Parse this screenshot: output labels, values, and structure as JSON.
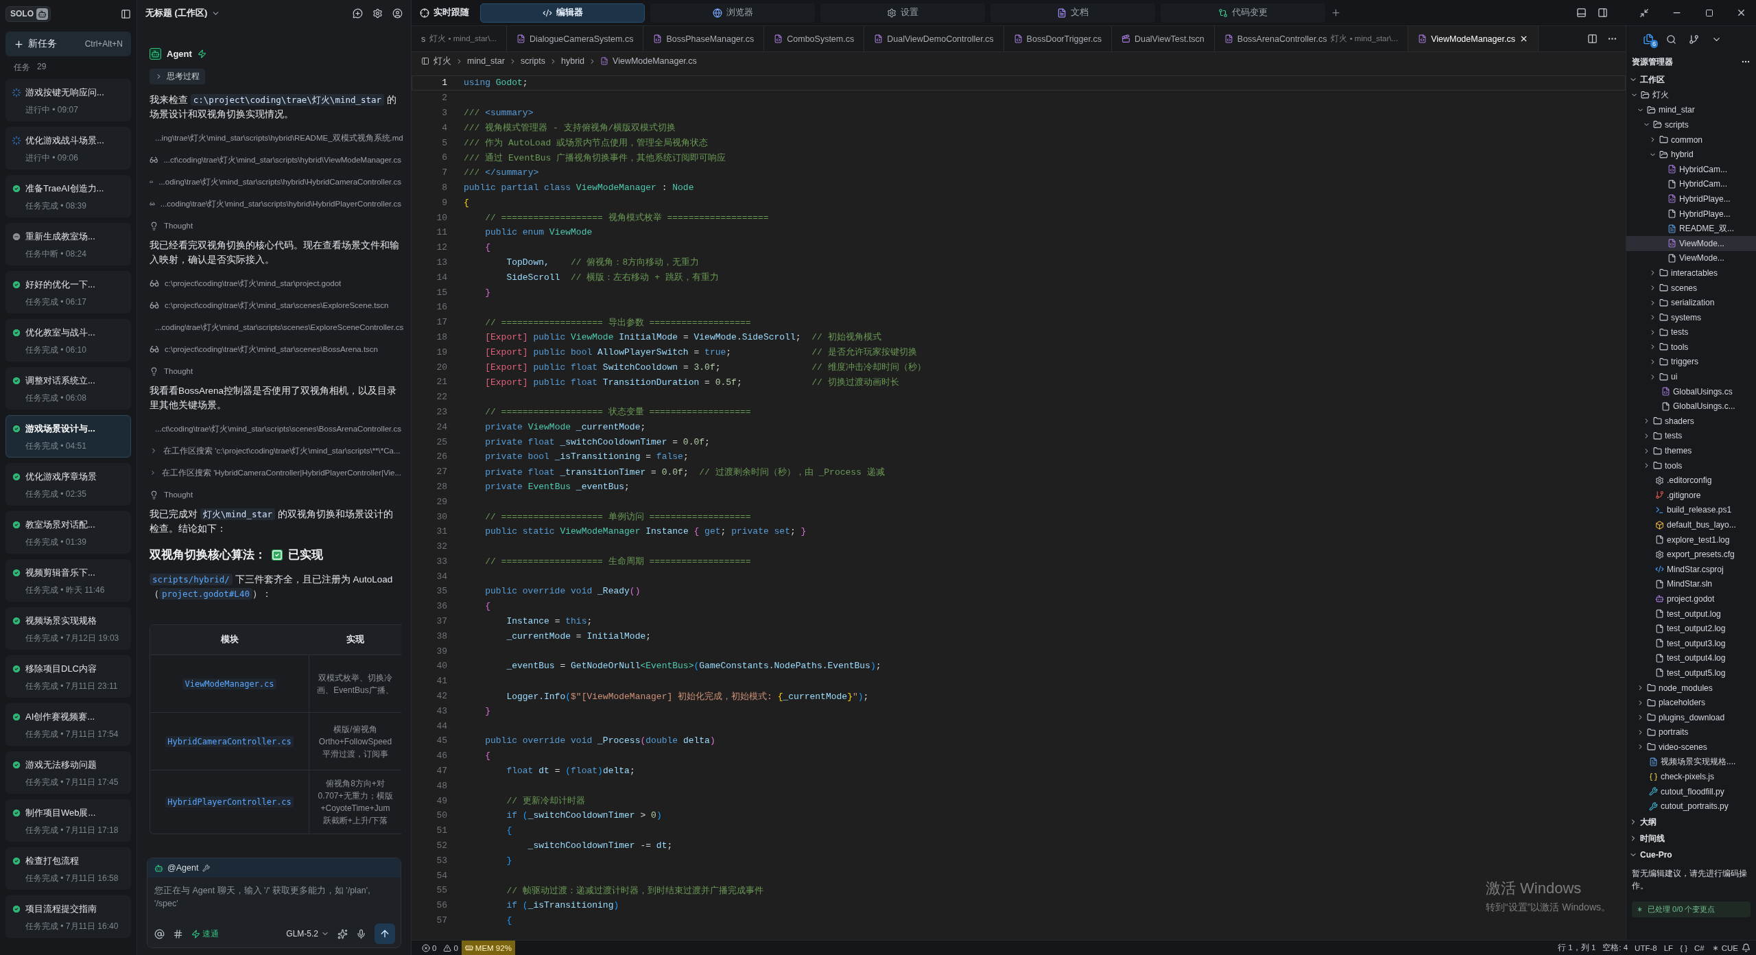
{
  "sidebar": {
    "brand": "SOLO",
    "new_task": {
      "label": "新任务",
      "shortcut": "Ctrl+Alt+N"
    },
    "tasks_label": "任务",
    "tasks_count": "29",
    "tasks": [
      {
        "title": "游戏按键无响应问...",
        "meta": "进行中 • 09:07",
        "kind": "running",
        "selected": false
      },
      {
        "title": "优化游戏战斗场景...",
        "meta": "进行中 • 09:06",
        "kind": "running",
        "selected": false
      },
      {
        "title": "准备TraeAI创造力...",
        "meta": "任务完成 • 08:39",
        "kind": "done",
        "selected": false
      },
      {
        "title": "重新生成教室场...",
        "meta": "任务中断 • 08:24",
        "kind": "stopped",
        "selected": false
      },
      {
        "title": "好好的优化一下...",
        "meta": "任务完成 • 06:17",
        "kind": "done",
        "selected": false
      },
      {
        "title": "优化教室与战斗...",
        "meta": "任务完成 • 06:10",
        "kind": "done",
        "selected": false
      },
      {
        "title": "调整对话系统立...",
        "meta": "任务完成 • 06:08",
        "kind": "done",
        "selected": false
      },
      {
        "title": "游戏场景设计与...",
        "meta": "任务完成 • 04:51",
        "kind": "done",
        "selected": true
      },
      {
        "title": "优化游戏序章场景",
        "meta": "任务完成 • 02:35",
        "kind": "done",
        "selected": false
      },
      {
        "title": "教室场景对话配...",
        "meta": "任务完成 • 01:39",
        "kind": "done",
        "selected": false
      },
      {
        "title": "视频剪辑音乐下...",
        "meta": "任务完成 • 昨天 11:46",
        "kind": "done",
        "selected": false
      },
      {
        "title": "视频场景实现规格",
        "meta": "任务完成 • 7月12日 19:03",
        "kind": "done",
        "selected": false
      },
      {
        "title": "移除项目DLC内容",
        "meta": "任务完成 • 7月11日 23:11",
        "kind": "done",
        "selected": false
      },
      {
        "title": "AI创作赛视频赛...",
        "meta": "任务完成 • 7月11日 17:54",
        "kind": "done",
        "selected": false
      },
      {
        "title": "游戏无法移动问题",
        "meta": "任务完成 • 7月11日 17:45",
        "kind": "done",
        "selected": false
      },
      {
        "title": "制作项目Web展...",
        "meta": "任务完成 • 7月11日 17:18",
        "kind": "done",
        "selected": false
      },
      {
        "title": "检查打包流程",
        "meta": "任务完成 • 7月11日 16:58",
        "kind": "done",
        "selected": false
      },
      {
        "title": "项目流程提交指南",
        "meta": "任务完成 • 7月11日 16:40",
        "kind": "done",
        "selected": false
      }
    ]
  },
  "agent": {
    "workspace": "无标题 (工作区)",
    "name": "Agent",
    "items": [
      {
        "kind": "toggle",
        "text": "思考过程"
      },
      {
        "kind": "para",
        "parts": [
          {
            "text": "我来检查 ",
            "code": false
          },
          {
            "text": "c:\\project\\coding\\trae\\灯火\\mind_star",
            "code": true
          },
          {
            "text": " 的场景设计和双视角切换实现情况。",
            "code": false
          }
        ]
      },
      {
        "kind": "read",
        "text": "...ing\\trae\\灯火\\mind_star\\scripts\\hybrid\\README_双模式视角系统.md"
      },
      {
        "kind": "read",
        "text": "...ct\\coding\\trae\\灯火\\mind_star\\scripts\\hybrid\\ViewModeManager.cs"
      },
      {
        "kind": "read",
        "text": "...oding\\trae\\灯火\\mind_star\\scripts\\hybrid\\HybridCameraController.cs"
      },
      {
        "kind": "read",
        "text": "...coding\\trae\\灯火\\mind_star\\scripts\\hybrid\\HybridPlayerController.cs"
      },
      {
        "kind": "thought",
        "text": "Thought"
      },
      {
        "kind": "para",
        "parts": [
          {
            "text": "我已经看完双视角切换的核心代码。现在查看场景文件和输入映射，确认是否实际接入。",
            "code": false
          }
        ]
      },
      {
        "kind": "read",
        "text": "c:\\project\\coding\\trae\\灯火\\mind_star\\project.godot"
      },
      {
        "kind": "read",
        "text": "c:\\project\\coding\\trae\\灯火\\mind_star\\scenes\\ExploreScene.tscn"
      },
      {
        "kind": "read",
        "text": "...coding\\trae\\灯火\\mind_star\\scripts\\scenes\\ExploreSceneController.cs"
      },
      {
        "kind": "read",
        "text": "c:\\project\\coding\\trae\\灯火\\mind_star\\scenes\\BossArena.tscn"
      },
      {
        "kind": "thought",
        "text": "Thought"
      },
      {
        "kind": "para",
        "parts": [
          {
            "text": "我看看BossArena控制器是否使用了双视角相机，以及目录里其他关键场景。",
            "code": false
          }
        ]
      },
      {
        "kind": "read",
        "text": "...ct\\coding\\trae\\灯火\\mind_star\\scripts\\scenes\\BossArenaController.cs"
      },
      {
        "kind": "search",
        "text": "在工作区搜索 'c:\\project\\coding\\trae\\灯火\\mind_star\\scripts\\**\\*Ca..."
      },
      {
        "kind": "search",
        "text": "在工作区搜索 'HybridCameraController|HybridPlayerController|Vie..."
      },
      {
        "kind": "thought",
        "text": "Thought"
      },
      {
        "kind": "para",
        "parts": [
          {
            "text": "我已完成对 ",
            "code": false
          },
          {
            "text": "灯火\\mind_star",
            "code": true
          },
          {
            "text": " 的双视角切换和场景设计的检查。结论如下：",
            "code": false
          }
        ]
      },
      {
        "kind": "heading",
        "text": "**双视角切换核心算法：**",
        "status": "已实现",
        "checked": true
      },
      {
        "kind": "para",
        "parts": [
          {
            "text": "scripts/hybrid/",
            "code": true
          },
          {
            "text": " 下三件套齐全，且已注册为 AutoLoad（",
            "code": false
          },
          {
            "text": "project.godot#L40",
            "code": true
          },
          {
            "text": "）：",
            "code": false
          }
        ]
      }
    ],
    "table": {
      "columns": [
        "模块",
        "实现"
      ],
      "rows": [
        {
          "module": "ViewModeManager.cs",
          "detail": [
            "双模式枚举、切换冷",
            "画、EventBus广播、"
          ]
        },
        {
          "module": "HybridCameraController.cs",
          "detail": [
            "横版/俯视角",
            "Ortho+FollowSpeed",
            "平滑过渡，订阅事"
          ]
        },
        {
          "module": "HybridPlayerController.cs",
          "detail": [
            "俯视角8方向+对",
            "0.707+无重力；横版",
            "+CoyoteTime+Jum",
            "跃截断+上升/下落"
          ]
        }
      ]
    },
    "composer": {
      "mention": "@Agent",
      "placeholder": "您正在与 Agent 聊天，输入 '/' 获取更多能力，如 '/plan', '/spec'",
      "mode": "速通",
      "model": "GLM-5.2"
    }
  },
  "topbar": {
    "follow": "实时跟随",
    "tabs": [
      {
        "label": "编辑器",
        "kind": "code",
        "selected": true
      },
      {
        "label": "浏览器",
        "kind": "browser",
        "selected": false
      },
      {
        "label": "设置",
        "kind": "settings",
        "selected": false
      },
      {
        "label": "文档",
        "kind": "docs",
        "selected": false
      },
      {
        "label": "代码变更",
        "kind": "diff",
        "selected": false
      }
    ]
  },
  "file_tabs": [
    {
      "name": "s",
      "detail": "灯火 • mind_star\\...",
      "kind": "none",
      "selected": false
    },
    {
      "name": "DialogueCameraSystem.cs",
      "kind": "cs",
      "selected": false
    },
    {
      "name": "BossPhaseManager.cs",
      "kind": "cs",
      "selected": false
    },
    {
      "name": "ComboSystem.cs",
      "kind": "cs",
      "selected": false
    },
    {
      "name": "DualViewDemoController.cs",
      "kind": "cs",
      "selected": false
    },
    {
      "name": "BossDoorTrigger.cs",
      "kind": "cs",
      "selected": false
    },
    {
      "name": "DualViewTest.tscn",
      "kind": "scene",
      "selected": false
    },
    {
      "name": "BossArenaController.cs",
      "detail": "灯火 • mind_star\\...",
      "kind": "cs",
      "selected": false
    },
    {
      "name": "ViewModeManager.cs",
      "kind": "cs",
      "selected": true
    }
  ],
  "breadcrumb": [
    "灯火",
    "mind_star",
    "scripts",
    "hybrid",
    "ViewModeManager.cs"
  ],
  "code": [
    {
      "no": "1",
      "current": true,
      "tokens": [
        {
          "kind": "kw",
          "text": "using"
        },
        {
          "kind": "ty",
          "text": " Godot"
        },
        {
          "kind": "pl",
          "text": ";"
        }
      ]
    },
    {
      "no": "2",
      "current": false
    },
    {
      "no": "3",
      "current": false,
      "tokens": [
        {
          "kind": "cm",
          "text": "/// "
        },
        {
          "kind": "kw",
          "text": "<summary>"
        }
      ]
    },
    {
      "no": "4",
      "current": false,
      "tokens": [
        {
          "kind": "cm",
          "text": "/// 视角模式管理器 - 支持俯视角/横版双模式切换"
        }
      ]
    },
    {
      "no": "5",
      "current": false,
      "tokens": [
        {
          "kind": "cm",
          "text": "/// 作为 AutoLoad 或场景内节点使用，管理全局视角状态"
        }
      ]
    },
    {
      "no": "6",
      "current": false,
      "tokens": [
        {
          "kind": "cm",
          "text": "/// 通过 EventBus 广播视角切换事件，其他系统订阅即可响应"
        }
      ]
    },
    {
      "no": "7",
      "current": false,
      "tokens": [
        {
          "kind": "cm",
          "text": "/// "
        },
        {
          "kind": "kw",
          "text": "</summary>"
        }
      ]
    },
    {
      "no": "8",
      "current": false,
      "tokens": [
        {
          "kind": "kw",
          "text": "public partial class "
        },
        {
          "kind": "ty",
          "text": "ViewModeManager"
        },
        {
          "kind": "pl",
          "text": " : "
        },
        {
          "kind": "ty",
          "text": "Node"
        }
      ]
    },
    {
      "no": "9",
      "current": false,
      "tokens": [
        {
          "kind": "br",
          "text": "{"
        }
      ]
    },
    {
      "no": "10",
      "current": false,
      "tokens": [
        {
          "kind": "cm",
          "text": "    // =================== 视角模式枚举 ==================="
        }
      ]
    },
    {
      "no": "11",
      "current": false,
      "tokens": [
        {
          "kind": "kw",
          "text": "    public enum "
        },
        {
          "kind": "ty",
          "text": "ViewMode"
        }
      ]
    },
    {
      "no": "12",
      "current": false,
      "tokens": [
        {
          "kind": "bp",
          "text": "    {"
        }
      ]
    },
    {
      "no": "13",
      "current": false,
      "tokens": [
        {
          "kind": "id",
          "text": "        TopDown,"
        },
        {
          "kind": "cm",
          "text": "    // 俯视角：8方向移动，无重力"
        }
      ]
    },
    {
      "no": "14",
      "current": false,
      "tokens": [
        {
          "kind": "id",
          "text": "        SideScroll"
        },
        {
          "kind": "cm",
          "text": "  // 横版：左右移动 + 跳跃，有重力"
        }
      ]
    },
    {
      "no": "15",
      "current": false,
      "tokens": [
        {
          "kind": "bp",
          "text": "    }"
        }
      ]
    },
    {
      "no": "16",
      "current": false
    },
    {
      "no": "17",
      "current": false,
      "tokens": [
        {
          "kind": "cm",
          "text": "    // =================== 导出参数 ==================="
        }
      ]
    },
    {
      "no": "18",
      "current": false,
      "tokens": [
        {
          "kind": "at",
          "text": "    [Export]"
        },
        {
          "kind": "kw",
          "text": " public "
        },
        {
          "kind": "ty",
          "text": "ViewMode"
        },
        {
          "kind": "id",
          "text": " InitialMode"
        },
        {
          "kind": "pl",
          "text": " = "
        },
        {
          "kind": "id",
          "text": "ViewMode.SideScroll"
        },
        {
          "kind": "pl",
          "text": ";"
        },
        {
          "kind": "cm",
          "text": "  // 初始视角模式"
        }
      ]
    },
    {
      "no": "19",
      "current": false,
      "tokens": [
        {
          "kind": "at",
          "text": "    [Export]"
        },
        {
          "kind": "kw",
          "text": " public bool"
        },
        {
          "kind": "id",
          "text": " AllowPlayerSwitch"
        },
        {
          "kind": "pl",
          "text": " = "
        },
        {
          "kind": "kw",
          "text": "true"
        },
        {
          "kind": "pl",
          "text": ";"
        },
        {
          "kind": "cm",
          "text": "               // 是否允许玩家按键切换"
        }
      ]
    },
    {
      "no": "20",
      "current": false,
      "tokens": [
        {
          "kind": "at",
          "text": "    [Export]"
        },
        {
          "kind": "kw",
          "text": " public float"
        },
        {
          "kind": "id",
          "text": " SwitchCooldown"
        },
        {
          "kind": "pl",
          "text": " = "
        },
        {
          "kind": "num",
          "text": "3.0f"
        },
        {
          "kind": "pl",
          "text": ";"
        },
        {
          "kind": "cm",
          "text": "                 // 维度冲击冷却时间（秒）"
        }
      ]
    },
    {
      "no": "21",
      "current": false,
      "tokens": [
        {
          "kind": "at",
          "text": "    [Export]"
        },
        {
          "kind": "kw",
          "text": " public float"
        },
        {
          "kind": "id",
          "text": " TransitionDuration"
        },
        {
          "kind": "pl",
          "text": " = "
        },
        {
          "kind": "num",
          "text": "0.5f"
        },
        {
          "kind": "pl",
          "text": ";"
        },
        {
          "kind": "cm",
          "text": "             // 切换过渡动画时长"
        }
      ]
    },
    {
      "no": "22",
      "current": false
    },
    {
      "no": "23",
      "current": false,
      "tokens": [
        {
          "kind": "cm",
          "text": "    // =================== 状态变量 ==================="
        }
      ]
    },
    {
      "no": "24",
      "current": false,
      "tokens": [
        {
          "kind": "kw",
          "text": "    private "
        },
        {
          "kind": "ty",
          "text": "ViewMode"
        },
        {
          "kind": "id",
          "text": " _currentMode"
        },
        {
          "kind": "pl",
          "text": ";"
        }
      ]
    },
    {
      "no": "25",
      "current": false,
      "tokens": [
        {
          "kind": "kw",
          "text": "    private float"
        },
        {
          "kind": "id",
          "text": " _switchCooldownTimer"
        },
        {
          "kind": "pl",
          "text": " = "
        },
        {
          "kind": "num",
          "text": "0.0f"
        },
        {
          "kind": "pl",
          "text": ";"
        }
      ]
    },
    {
      "no": "26",
      "current": false,
      "tokens": [
        {
          "kind": "kw",
          "text": "    private bool"
        },
        {
          "kind": "id",
          "text": " _isTransitioning"
        },
        {
          "kind": "pl",
          "text": " = "
        },
        {
          "kind": "kw",
          "text": "false"
        },
        {
          "kind": "pl",
          "text": ";"
        }
      ]
    },
    {
      "no": "27",
      "current": false,
      "tokens": [
        {
          "kind": "kw",
          "text": "    private float"
        },
        {
          "kind": "id",
          "text": " _transitionTimer"
        },
        {
          "kind": "pl",
          "text": " = "
        },
        {
          "kind": "num",
          "text": "0.0f"
        },
        {
          "kind": "pl",
          "text": ";"
        },
        {
          "kind": "cm",
          "text": "  // 过渡剩余时间（秒），由 _Process 递减"
        }
      ]
    },
    {
      "no": "28",
      "current": false,
      "tokens": [
        {
          "kind": "kw",
          "text": "    private "
        },
        {
          "kind": "ty",
          "text": "EventBus"
        },
        {
          "kind": "id",
          "text": " _eventBus"
        },
        {
          "kind": "pl",
          "text": ";"
        }
      ]
    },
    {
      "no": "29",
      "current": false
    },
    {
      "no": "30",
      "current": false,
      "tokens": [
        {
          "kind": "cm",
          "text": "    // =================== 单例访问 ==================="
        }
      ]
    },
    {
      "no": "31",
      "current": false,
      "tokens": [
        {
          "kind": "kw",
          "text": "    public static "
        },
        {
          "kind": "ty",
          "text": "ViewModeManager"
        },
        {
          "kind": "id",
          "text": " Instance "
        },
        {
          "kind": "bp",
          "text": "{"
        },
        {
          "kind": "kw",
          "text": " get"
        },
        {
          "kind": "pl",
          "text": "; "
        },
        {
          "kind": "kw",
          "text": "private set"
        },
        {
          "kind": "pl",
          "text": "; "
        },
        {
          "kind": "bp",
          "text": "}"
        }
      ]
    },
    {
      "no": "32",
      "current": false
    },
    {
      "no": "33",
      "current": false,
      "tokens": [
        {
          "kind": "cm",
          "text": "    // =================== 生命周期 ==================="
        }
      ]
    },
    {
      "no": "34",
      "current": false
    },
    {
      "no": "35",
      "current": false,
      "tokens": [
        {
          "kind": "kw",
          "text": "    public override void "
        },
        {
          "kind": "id",
          "text": "_Ready"
        },
        {
          "kind": "bp",
          "text": "()"
        }
      ]
    },
    {
      "no": "36",
      "current": false,
      "tokens": [
        {
          "kind": "bp",
          "text": "    {"
        }
      ]
    },
    {
      "no": "37",
      "current": false,
      "tokens": [
        {
          "kind": "id",
          "text": "        Instance"
        },
        {
          "kind": "pl",
          "text": " = "
        },
        {
          "kind": "kw",
          "text": "this"
        },
        {
          "kind": "pl",
          "text": ";"
        }
      ]
    },
    {
      "no": "38",
      "current": false,
      "tokens": [
        {
          "kind": "id",
          "text": "        _currentMode"
        },
        {
          "kind": "pl",
          "text": " = "
        },
        {
          "kind": "id",
          "text": "InitialMode"
        },
        {
          "kind": "pl",
          "text": ";"
        }
      ]
    },
    {
      "no": "39",
      "current": false
    },
    {
      "no": "40",
      "current": false,
      "tokens": [
        {
          "kind": "id",
          "text": "        _eventBus"
        },
        {
          "kind": "pl",
          "text": " = "
        },
        {
          "kind": "id",
          "text": "GetNodeOrNull"
        },
        {
          "kind": "ty",
          "text": "<EventBus>"
        },
        {
          "kind": "bb",
          "text": "("
        },
        {
          "kind": "id",
          "text": "GameConstants.NodePaths.EventBus"
        },
        {
          "kind": "bb",
          "text": ")"
        },
        {
          "kind": "pl",
          "text": ";"
        }
      ]
    },
    {
      "no": "41",
      "current": false
    },
    {
      "no": "42",
      "current": false,
      "tokens": [
        {
          "kind": "id",
          "text": "        Logger.Info"
        },
        {
          "kind": "bb",
          "text": "("
        },
        {
          "kind": "str",
          "text": "$\"[ViewModeManager] 初始化完成，初始模式: "
        },
        {
          "kind": "br",
          "text": "{"
        },
        {
          "kind": "id",
          "text": "_currentMode"
        },
        {
          "kind": "br",
          "text": "}"
        },
        {
          "kind": "str",
          "text": "\""
        },
        {
          "kind": "bb",
          "text": ")"
        },
        {
          "kind": "pl",
          "text": ";"
        }
      ]
    },
    {
      "no": "43",
      "current": false,
      "tokens": [
        {
          "kind": "bp",
          "text": "    }"
        }
      ]
    },
    {
      "no": "44",
      "current": false
    },
    {
      "no": "45",
      "current": false,
      "tokens": [
        {
          "kind": "kw",
          "text": "    public override void "
        },
        {
          "kind": "id",
          "text": "_Process"
        },
        {
          "kind": "bp",
          "text": "("
        },
        {
          "kind": "kw",
          "text": "double "
        },
        {
          "kind": "id",
          "text": "delta"
        },
        {
          "kind": "bp",
          "text": ")"
        }
      ]
    },
    {
      "no": "46",
      "current": false,
      "tokens": [
        {
          "kind": "bp",
          "text": "    {"
        }
      ]
    },
    {
      "no": "47",
      "current": false,
      "tokens": [
        {
          "kind": "kw",
          "text": "        float "
        },
        {
          "kind": "id",
          "text": "dt"
        },
        {
          "kind": "pl",
          "text": " = "
        },
        {
          "kind": "bb",
          "text": "("
        },
        {
          "kind": "kw",
          "text": "float"
        },
        {
          "kind": "bb",
          "text": ")"
        },
        {
          "kind": "id",
          "text": "delta"
        },
        {
          "kind": "pl",
          "text": ";"
        }
      ]
    },
    {
      "no": "48",
      "current": false
    },
    {
      "no": "49",
      "current": false,
      "tokens": [
        {
          "kind": "cm",
          "text": "        // 更新冷却计时器"
        }
      ]
    },
    {
      "no": "50",
      "current": false,
      "tokens": [
        {
          "kind": "kw",
          "text": "        if "
        },
        {
          "kind": "bb",
          "text": "("
        },
        {
          "kind": "id",
          "text": "_switchCooldownTimer"
        },
        {
          "kind": "pl",
          "text": " > "
        },
        {
          "kind": "num",
          "text": "0"
        },
        {
          "kind": "bb",
          "text": ")"
        }
      ]
    },
    {
      "no": "51",
      "current": false,
      "tokens": [
        {
          "kind": "bb",
          "text": "        {"
        }
      ]
    },
    {
      "no": "52",
      "current": false,
      "tokens": [
        {
          "kind": "id",
          "text": "            _switchCooldownTimer"
        },
        {
          "kind": "pl",
          "text": " -= "
        },
        {
          "kind": "id",
          "text": "dt"
        },
        {
          "kind": "pl",
          "text": ";"
        }
      ]
    },
    {
      "no": "53",
      "current": false,
      "tokens": [
        {
          "kind": "bb",
          "text": "        }"
        }
      ]
    },
    {
      "no": "54",
      "current": false
    },
    {
      "no": "55",
      "current": false,
      "tokens": [
        {
          "kind": "cm",
          "text": "        // 帧驱动过渡：递减过渡计时器，到时结束过渡并广播完成事件"
        }
      ]
    },
    {
      "no": "56",
      "current": false,
      "tokens": [
        {
          "kind": "kw",
          "text": "        if "
        },
        {
          "kind": "bb",
          "text": "("
        },
        {
          "kind": "id",
          "text": "_isTransitioning"
        },
        {
          "kind": "bb",
          "text": ")"
        }
      ]
    },
    {
      "no": "57",
      "current": false,
      "tokens": [
        {
          "kind": "bb",
          "text": "        {"
        }
      ]
    }
  ],
  "explorer": {
    "title": "资源管理器",
    "badge": "6",
    "sections": [
      {
        "title": "工作区",
        "expanded": true,
        "tree": [
          {
            "name": "灯火",
            "kind": "folder",
            "expanded": true,
            "selected": false,
            "children": [
              {
                "name": "mind_star",
                "kind": "folder",
                "expanded": true,
                "selected": false,
                "children": [
                  {
                    "name": "scripts",
                    "kind": "folder",
                    "expanded": true,
                    "selected": false,
                    "children": [
                      {
                        "name": "common",
                        "kind": "folder",
                        "expanded": false,
                        "selected": false
                      },
                      {
                        "name": "hybrid",
                        "kind": "folder",
                        "expanded": true,
                        "selected": false,
                        "children": [
                          {
                            "name": "HybridCam...",
                            "kind": "cs",
                            "selected": false
                          },
                          {
                            "name": "HybridCam...",
                            "kind": "file",
                            "selected": false
                          },
                          {
                            "name": "HybridPlaye...",
                            "kind": "cs",
                            "selected": false
                          },
                          {
                            "name": "HybridPlaye...",
                            "kind": "file",
                            "selected": false
                          },
                          {
                            "name": "README_双...",
                            "kind": "md",
                            "selected": false
                          },
                          {
                            "name": "ViewMode...",
                            "kind": "cs",
                            "selected": true
                          },
                          {
                            "name": "ViewMode...",
                            "kind": "file",
                            "selected": false
                          }
                        ]
                      },
                      {
                        "name": "interactables",
                        "kind": "folder",
                        "expanded": false,
                        "selected": false
                      },
                      {
                        "name": "scenes",
                        "kind": "folder",
                        "expanded": false,
                        "selected": false
                      },
                      {
                        "name": "serialization",
                        "kind": "folder",
                        "expanded": false,
                        "selected": false
                      },
                      {
                        "name": "systems",
                        "kind": "folder",
                        "expanded": false,
                        "selected": false
                      },
                      {
                        "name": "tests",
                        "kind": "folder",
                        "expanded": false,
                        "selected": false
                      },
                      {
                        "name": "tools",
                        "kind": "folder",
                        "expanded": false,
                        "selected": false
                      },
                      {
                        "name": "triggers",
                        "kind": "folder",
                        "expanded": false,
                        "selected": false
                      },
                      {
                        "name": "ui",
                        "kind": "folder",
                        "expanded": false,
                        "selected": false
                      },
                      {
                        "name": "GlobalUsings.cs",
                        "kind": "cs",
                        "selected": false
                      },
                      {
                        "name": "GlobalUsings.c...",
                        "kind": "file",
                        "selected": false
                      }
                    ]
                  },
                  {
                    "name": "shaders",
                    "kind": "folder",
                    "expanded": false,
                    "selected": false
                  },
                  {
                    "name": "tests",
                    "kind": "folder",
                    "expanded": false,
                    "selected": false
                  },
                  {
                    "name": "themes",
                    "kind": "folder",
                    "expanded": false,
                    "selected": false
                  },
                  {
                    "name": "tools",
                    "kind": "folder",
                    "expanded": false,
                    "selected": false
                  },
                  {
                    "name": ".editorconfig",
                    "kind": "config",
                    "selected": false
                  },
                  {
                    "name": ".gitignore",
                    "kind": "git",
                    "selected": false
                  },
                  {
                    "name": "build_release.ps1",
                    "kind": "shell",
                    "selected": false
                  },
                  {
                    "name": "default_bus_layo...",
                    "kind": "res",
                    "selected": false
                  },
                  {
                    "name": "explore_test1.log",
                    "kind": "file",
                    "selected": false
                  },
                  {
                    "name": "export_presets.cfg",
                    "kind": "config",
                    "selected": false
                  },
                  {
                    "name": "MindStar.csproj",
                    "kind": "xml",
                    "selected": false
                  },
                  {
                    "name": "MindStar.sln",
                    "kind": "file",
                    "selected": false
                  },
                  {
                    "name": "project.godot",
                    "kind": "godot",
                    "selected": false
                  },
                  {
                    "name": "test_output.log",
                    "kind": "file",
                    "selected": false
                  },
                  {
                    "name": "test_output2.log",
                    "kind": "file",
                    "selected": false
                  },
                  {
                    "name": "test_output3.log",
                    "kind": "file",
                    "selected": false
                  },
                  {
                    "name": "test_output4.log",
                    "kind": "file",
                    "selected": false
                  },
                  {
                    "name": "test_output5.log",
                    "kind": "file",
                    "selected": false
                  }
                ]
              },
              {
                "name": "node_modules",
                "kind": "folder",
                "expanded": false,
                "selected": false
              },
              {
                "name": "placeholders",
                "kind": "folder",
                "expanded": false,
                "selected": false
              },
              {
                "name": "plugins_download",
                "kind": "folder",
                "expanded": false,
                "selected": false
              },
              {
                "name": "portraits",
                "kind": "folder",
                "expanded": false,
                "selected": false
              },
              {
                "name": "video-scenes",
                "kind": "folder",
                "expanded": false,
                "selected": false
              },
              {
                "name": "视频场景实现规格....",
                "kind": "md",
                "selected": false
              },
              {
                "name": "check-pixels.js",
                "kind": "js",
                "selected": false
              },
              {
                "name": "cutout_floodfill.py",
                "kind": "py",
                "selected": false
              },
              {
                "name": "cutout_portraits.py",
                "kind": "py",
                "selected": false
              }
            ]
          }
        ]
      },
      {
        "title": "大纲",
        "expanded": false
      },
      {
        "title": "时间线",
        "expanded": false
      },
      {
        "title": "Cue-Pro",
        "expanded": true,
        "message": "暂无编辑建议，请先进行编码操作。",
        "status": "已处理 0/0 个变更点"
      }
    ]
  },
  "status_bar": {
    "errors": "0",
    "warnings": "0",
    "memory": "MEM 92%",
    "position": "行 1，列 1",
    "indent": "空格: 4",
    "encoding": "UTF-8",
    "eol": "LF",
    "braces": "{ }",
    "language": "C#",
    "cue": "CUE"
  },
  "os_notice": {
    "title": "激活 Windows",
    "text": "转到“设置”以激活 Windows。"
  }
}
